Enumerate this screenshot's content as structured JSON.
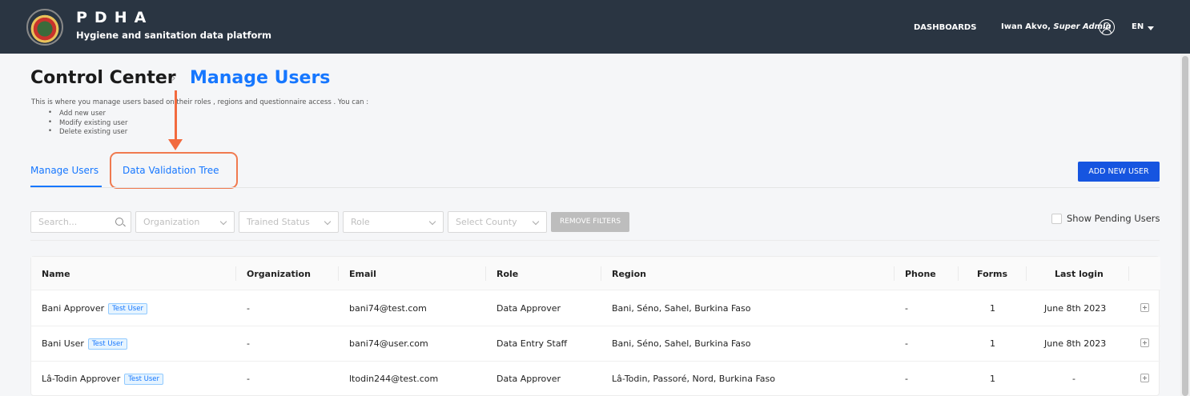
{
  "header": {
    "brand_title": "PDHA",
    "brand_subtitle": "Hygiene and sanitation data platform",
    "nav_dashboards": "DASHBOARDS",
    "user_name": "Iwan Akvo, ",
    "user_role": "Super Admin",
    "language": "EN"
  },
  "breadcrumb": {
    "parent": "Control Center",
    "separator": "›",
    "current": "Manage Users"
  },
  "description": {
    "text": "This is where you manage users based on their roles , regions and questionnaire access . You can :",
    "bullets": [
      "Add new user",
      "Modify existing user",
      "Delete existing user"
    ]
  },
  "tabs": [
    {
      "label": "Manage Users",
      "active": true
    },
    {
      "label": "Data Validation Tree",
      "active": false
    }
  ],
  "add_button": "ADD NEW USER",
  "filters": {
    "search_placeholder": "Search...",
    "organization": "Organization",
    "trained_status": "Trained Status",
    "role": "Role",
    "county": "Select County",
    "remove": "REMOVE FILTERS",
    "show_pending": "Show Pending Users"
  },
  "table": {
    "columns": [
      "Name",
      "Organization",
      "Email",
      "Role",
      "Region",
      "Phone",
      "Forms",
      "Last login"
    ],
    "rows": [
      {
        "name": "Bani Approver",
        "tag": "Test User",
        "organization": "-",
        "email": "bani74@test.com",
        "role": "Data Approver",
        "region": "Bani, Séno, Sahel, Burkina Faso",
        "phone": "-",
        "forms": "1",
        "last_login": "June 8th 2023"
      },
      {
        "name": "Bani User",
        "tag": "Test User",
        "organization": "-",
        "email": "bani74@user.com",
        "role": "Data Entry Staff",
        "region": "Bani, Séno, Sahel, Burkina Faso",
        "phone": "-",
        "forms": "1",
        "last_login": "June 8th 2023"
      },
      {
        "name": "Lâ-Todin Approver",
        "tag": "Test User",
        "organization": "-",
        "email": "ltodin244@test.com",
        "role": "Data Approver",
        "region": "Lâ-Todin, Passoré, Nord, Burkina Faso",
        "phone": "-",
        "forms": "1",
        "last_login": "-"
      }
    ]
  },
  "colors": {
    "header_bg": "#2a3542",
    "accent": "#1677ff",
    "add_button": "#1655e0",
    "annotation": "#f26a3e"
  }
}
